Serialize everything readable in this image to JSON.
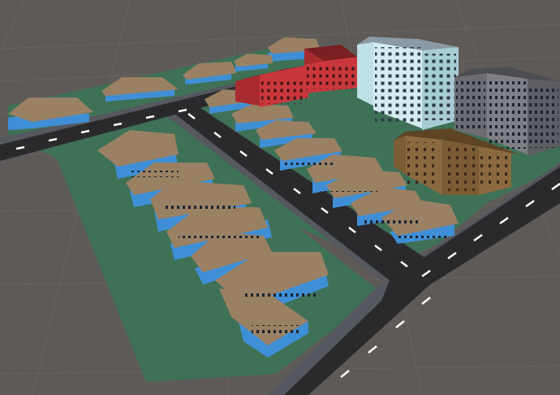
{
  "scene": {
    "type": "3d-city-block-viewport",
    "colors": {
      "ground": "#5e5a57",
      "grid_line": "#6b6764",
      "grass": "#3f7157",
      "road": "#2a2a2c",
      "sidewalk": "#55585e",
      "lane_mark": "#ffffff",
      "house_wall": "#3f8fd6",
      "house_roof": "#9a8164",
      "red_building": "#c9373c",
      "light_tower": "#bfe0e6",
      "dark_tower": "#6c6d73",
      "brown_block": "#8a6a3e",
      "window_dark": "#1c2430"
    },
    "objects": [
      "grass-lot-left",
      "grass-lot-back",
      "grass-lot-right",
      "main-road-diagonal",
      "cross-road-back",
      "cross-road-front",
      "house-row-left",
      "house-row-center",
      "house-row-back",
      "red-apartment",
      "light-highrise",
      "gray-highrise",
      "brown-apartment"
    ]
  }
}
